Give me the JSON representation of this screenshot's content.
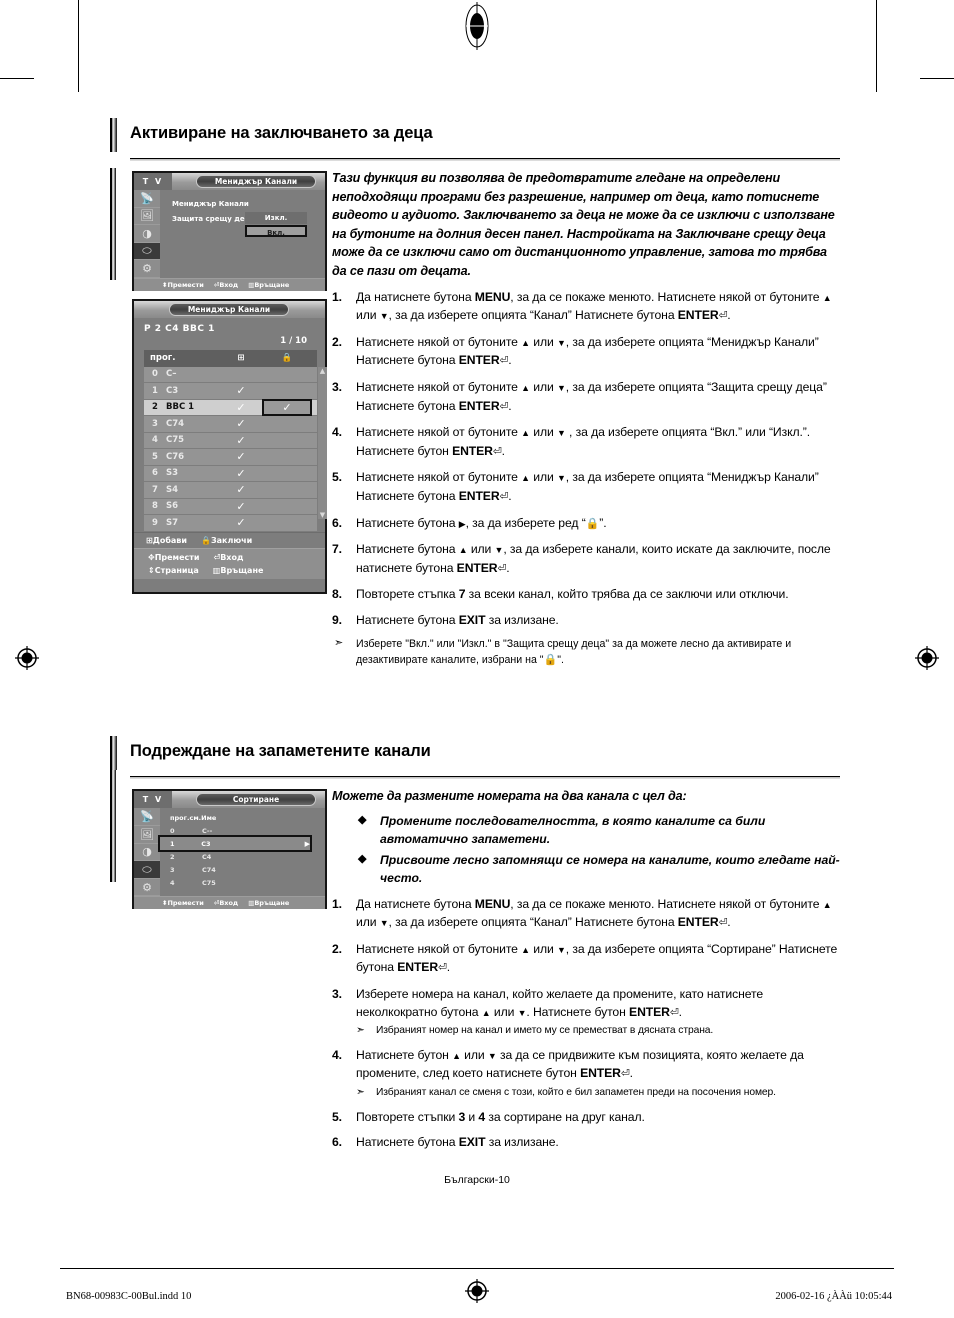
{
  "sections": [
    {
      "title": "Активиране на заключването за деца",
      "intro": "Тази функция ви позволява де предотвратите гледане на определени неподходящи програми без разрешение, например от деца, като потиснете видеото и аудиото. Заключването за деца не може да се изключи с използване на бутоните на долния десен панел. Настройката на Заключване срещу деца може да се изключи само от дистанционното управление, затова то трябва да се пази от децата.",
      "steps": [
        {
          "num": "1.",
          "text_parts": [
            "Да натиснете бутона ",
            "MENU",
            ", за да се покаже менюто. Натиснете някой от бутоните ",
            "▲",
            " или ",
            "▼",
            ", за да изберете опцията “Канал” Натиснете бутона ",
            "ENTER",
            "⏎",
            "."
          ]
        },
        {
          "num": "2.",
          "text": "Натиснете някой от бутоните ▲ или ▼, за да изберете опцията “Мениджър Канали” Натиснете бутона ENTER⏎."
        },
        {
          "num": "3.",
          "text": "Натиснете някой от бутоните ▲ или ▼, за да изберете опцията “Защита срещу деца” Натиснете бутона ENTER⏎."
        },
        {
          "num": "4.",
          "text": "Натиснете някой от бутоните ▲ или ▼ , за да изберете опцията “Вкл.” или “Изкл.”. Натиснете бутон ENTER⏎."
        },
        {
          "num": "5.",
          "text": "Натиснете някой от бутоните ▲ или ▼, за да изберете опцията “Мениджър Канали” Натиснете бутона ENTER⏎."
        },
        {
          "num": "6.",
          "text": "Натиснете бутона ▶, за да изберете ред  “🔒”."
        },
        {
          "num": "7.",
          "text": "Натиснете бутона ▲ или ▼, за да изберете канали, които искате да заключите, после натиснете бутона ENTER⏎."
        },
        {
          "num": "8.",
          "text": "Повторете стъпка 7 за всеки канал, който трябва да се заключи или отключи."
        },
        {
          "num": "9.",
          "text": "Натиснете бутона EXIT за излизане."
        }
      ],
      "note": "Изберете \"Вкл.\" или \"Изкл.\" в \"Защита срещу деца\" за да можете лесно да активирате и дезактивирате каналите, избрани на \"🔒\"."
    },
    {
      "title": "Подреждане на запаметените канали",
      "intro": "Можете да размените номерата на два канала с цел да:",
      "bullets": [
        "Промените последователността, в която каналите са били автоматично запаметени.",
        "Присвоите лесно запомнящи се номера на каналите, които гледате най-често."
      ],
      "steps": [
        {
          "num": "1.",
          "text": "Да натиснете бутона MENU, за да се покаже менюто. Натиснете някой от бутоните ▲ или ▼, за да изберете опцията “Канал” Натиснете бутона ENTER⏎."
        },
        {
          "num": "2.",
          "text": "Натиснете някой от бутоните ▲ или ▼, за да изберете опцията “Сортиране” Натиснете бутона ENTER⏎."
        },
        {
          "num": "3.",
          "text": "Изберете номера на канал, който желаете да промените, като натиснете неколкократно бутона ▲ или ▼. Натиснете бутон ENTER⏎.",
          "subnote": "Избраният номер на канал и името му се преместват в дясната страна."
        },
        {
          "num": "4.",
          "text": "Натиснете бутон ▲ или ▼ за да се придвижите към позицията, която желаете да промените, след което натиснете бутон ENTER⏎.",
          "subnote": "Избраният канал се сменя с този, който е бил запаметен преди на посочения номер."
        },
        {
          "num": "5.",
          "text": "Повторете стъпки 3 и 4 за сортиране на друг канал."
        },
        {
          "num": "6.",
          "text": "Натиснете бутона EXIT за излизане."
        }
      ]
    }
  ],
  "osd_child_lock": {
    "tv_label": "T V",
    "title": "Мениджър Канали",
    "menu_label": "Мениджър Канали",
    "field_label": "Защита срещу деца :",
    "option_off": "Изкл.",
    "option_on": "Вкл.",
    "footer": [
      "Премести",
      "Вход",
      "Връщане"
    ],
    "rail_icons": [
      "antenna-icon",
      "picture-icon",
      "sound-icon",
      "satellite-icon",
      "setup-icon"
    ]
  },
  "osd_channel_manager": {
    "title": "Мениджър Канали",
    "current_channel": "P 2  C4     BBC 1",
    "page_indicator": "1 / 10",
    "columns": [
      "прог.",
      "⊞",
      "🔒"
    ],
    "rows": [
      {
        "no": "0",
        "name": "C–",
        "add": "",
        "lock": ""
      },
      {
        "no": "1",
        "name": "C3",
        "add": "✓",
        "lock": ""
      },
      {
        "no": "2",
        "name": "BBC 1",
        "add": "✓",
        "lock": "✓",
        "current": true
      },
      {
        "no": "3",
        "name": "C74",
        "add": "✓",
        "lock": ""
      },
      {
        "no": "4",
        "name": "C75",
        "add": "✓",
        "lock": ""
      },
      {
        "no": "5",
        "name": "C76",
        "add": "✓",
        "lock": ""
      },
      {
        "no": "6",
        "name": "S3",
        "add": "✓",
        "lock": ""
      },
      {
        "no": "7",
        "name": "S4",
        "add": "✓",
        "lock": ""
      },
      {
        "no": "8",
        "name": "S6",
        "add": "✓",
        "lock": ""
      },
      {
        "no": "9",
        "name": "S7",
        "add": "✓",
        "lock": ""
      }
    ],
    "actions": [
      "Добави",
      "Заключи"
    ],
    "footer": [
      "Премести",
      "Вход",
      "Страница",
      "Връщане"
    ]
  },
  "osd_sort": {
    "tv_label": "T V",
    "title": "Сортиране",
    "columns": [
      "прог.",
      "см.",
      "Име"
    ],
    "rows": [
      {
        "no": "0",
        "ch": "C--",
        "name": ""
      },
      {
        "no": "1",
        "ch": "C3",
        "name": "",
        "selected": true
      },
      {
        "no": "2",
        "ch": "C4",
        "name": ""
      },
      {
        "no": "3",
        "ch": "C74",
        "name": ""
      },
      {
        "no": "4",
        "ch": "C75",
        "name": ""
      }
    ],
    "footer": [
      "Премести",
      "Вход",
      "Връщане"
    ]
  },
  "footer": {
    "page_label": "Български-10",
    "file_left": "BN68-00983C-00Bul.indd   10",
    "file_right": "2006-02-16   ¿ÀÀü 10:05:44"
  }
}
